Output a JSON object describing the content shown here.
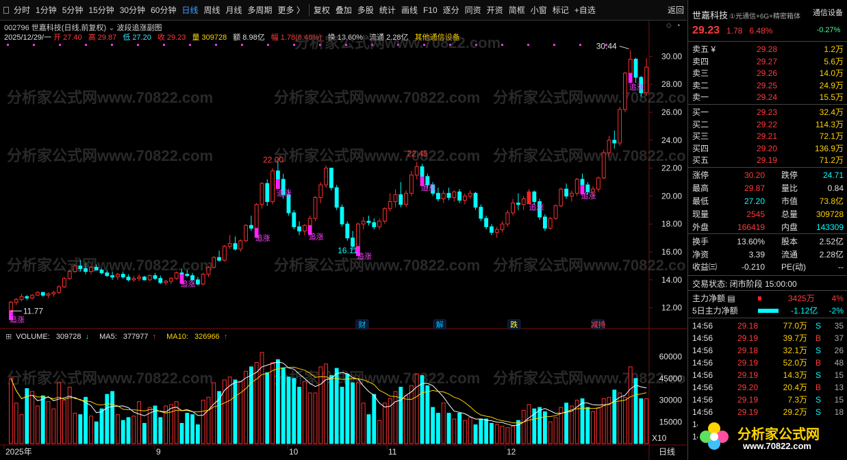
{
  "toolbar": {
    "periods": [
      "分时",
      "1分钟",
      "5分钟",
      "15分钟",
      "30分钟",
      "60分钟",
      "日线",
      "周线",
      "月线",
      "多周期",
      "更多 〉"
    ],
    "active": "日线",
    "tools": [
      "复权",
      "叠加",
      "多股",
      "统计",
      "画线",
      "F10",
      "逐分",
      "同资",
      "开资",
      "简框",
      "小窗",
      "标记",
      "+自选",
      "返回"
    ]
  },
  "stock": {
    "code": "002796",
    "name": "世嘉科技",
    "mode": "(日线,前复权)",
    "indicator": "波段追涨副图"
  },
  "quote_line": {
    "date": "2025/12/29/一",
    "open_label": "开",
    "open": "27.40",
    "high_label": "高",
    "high": "29.87",
    "low_label": "低",
    "low": "27.20",
    "close_label": "收",
    "close": "29.23",
    "vol_label": "量",
    "vol": "309728",
    "amt_label": "额",
    "amt": "8.98亿",
    "chg_label": "幅",
    "chg": "1.78(6.48%)",
    "turn_label": "换",
    "turn": "13.60%",
    "float_label": "流通",
    "float": "2.28亿",
    "sector": "其他通信设备"
  },
  "watermark": "分析家公式网www.70822.com",
  "chart_data": [
    {
      "type": "candlestick",
      "title": "",
      "ylim": [
        11,
        31
      ],
      "yticks": [
        12.0,
        14.0,
        16.0,
        18.0,
        20.0,
        22.0,
        24.0,
        26.0,
        28.0,
        30.0
      ],
      "xtick_labels": [
        "2025年",
        "9",
        "10",
        "11",
        "12"
      ],
      "annotations": {
        "max_labels": [
          "22.00",
          "22.45",
          "30.44"
        ],
        "min_labels": [
          "11.77",
          "16.11"
        ],
        "signal": "追涨",
        "events": [
          "财",
          "解",
          "跌",
          "减持"
        ]
      },
      "ohlc": [
        [
          11.8,
          12.5,
          11.77,
          12.4
        ],
        [
          12.4,
          12.7,
          12.2,
          12.6
        ],
        [
          12.6,
          13.0,
          12.45,
          12.8
        ],
        [
          12.8,
          12.9,
          12.55,
          12.7
        ],
        [
          12.7,
          13.0,
          12.6,
          12.9
        ],
        [
          12.9,
          13.2,
          12.85,
          13.1
        ],
        [
          13.1,
          13.0,
          12.8,
          12.9
        ],
        [
          12.9,
          13.1,
          12.7,
          13.0
        ],
        [
          13.0,
          13.2,
          12.8,
          13.1
        ],
        [
          13.1,
          13.6,
          13.0,
          13.5
        ],
        [
          13.5,
          14.2,
          13.4,
          14.1
        ],
        [
          14.1,
          14.7,
          14.0,
          14.6
        ],
        [
          14.6,
          15.1,
          14.5,
          15.0
        ],
        [
          15.0,
          15.4,
          14.6,
          14.8
        ],
        [
          14.8,
          15.2,
          14.4,
          14.6
        ],
        [
          14.6,
          15.0,
          14.4,
          14.9
        ],
        [
          14.9,
          15.1,
          14.7,
          14.7
        ],
        [
          14.7,
          14.8,
          14.4,
          14.5
        ],
        [
          14.5,
          14.7,
          14.2,
          14.3
        ],
        [
          14.3,
          14.6,
          14.0,
          14.2
        ],
        [
          14.2,
          14.5,
          14.0,
          14.4
        ],
        [
          14.4,
          14.6,
          14.1,
          14.2
        ],
        [
          14.2,
          14.4,
          13.9,
          14.0
        ],
        [
          14.0,
          14.3,
          13.85,
          14.1
        ],
        [
          14.1,
          14.4,
          13.9,
          14.2
        ],
        [
          14.2,
          14.3,
          13.95,
          14.0
        ],
        [
          14.0,
          14.4,
          13.9,
          14.3
        ],
        [
          14.3,
          14.5,
          14.0,
          14.1
        ],
        [
          14.1,
          14.3,
          13.7,
          13.8
        ],
        [
          13.8,
          14.0,
          13.6,
          13.9
        ],
        [
          13.9,
          14.2,
          13.7,
          14.1
        ],
        [
          14.1,
          14.6,
          14.0,
          14.5
        ],
        [
          14.5,
          14.8,
          14.3,
          14.4
        ],
        [
          14.4,
          14.7,
          14.2,
          14.3
        ],
        [
          14.3,
          14.5,
          13.9,
          14.0
        ],
        [
          14.0,
          14.2,
          13.6,
          13.7
        ],
        [
          13.7,
          14.5,
          13.6,
          14.4
        ],
        [
          14.4,
          15.0,
          14.2,
          14.9
        ],
        [
          14.9,
          15.7,
          14.8,
          15.6
        ],
        [
          15.6,
          16.1,
          15.3,
          15.4
        ],
        [
          15.4,
          16.5,
          15.3,
          16.4
        ],
        [
          16.4,
          17.2,
          16.2,
          16.6
        ],
        [
          16.6,
          17.1,
          16.1,
          16.2
        ],
        [
          16.2,
          16.9,
          16.0,
          16.8
        ],
        [
          16.8,
          18.0,
          16.7,
          17.9
        ],
        [
          17.9,
          18.6,
          17.5,
          17.7
        ],
        [
          17.7,
          19.5,
          17.6,
          19.4
        ],
        [
          19.4,
          21.0,
          19.1,
          20.9
        ],
        [
          20.9,
          21.2,
          19.3,
          19.6
        ],
        [
          19.6,
          22.0,
          19.4,
          21.8
        ],
        [
          21.8,
          22.5,
          20.8,
          21.2
        ],
        [
          21.2,
          21.6,
          19.8,
          20.1
        ],
        [
          20.1,
          20.5,
          18.6,
          18.8
        ],
        [
          18.8,
          19.0,
          17.6,
          17.8
        ],
        [
          17.8,
          18.2,
          17.2,
          17.5
        ],
        [
          17.5,
          18.0,
          17.2,
          17.9
        ],
        [
          17.9,
          18.6,
          17.7,
          18.4
        ],
        [
          18.4,
          20.0,
          18.2,
          19.9
        ],
        [
          19.9,
          21.0,
          19.5,
          20.8
        ],
        [
          20.8,
          22.2,
          20.6,
          22.0
        ],
        [
          22.0,
          21.9,
          20.4,
          20.6
        ],
        [
          20.6,
          20.8,
          19.0,
          19.2
        ],
        [
          19.2,
          19.4,
          17.8,
          18.0
        ],
        [
          18.0,
          18.2,
          16.8,
          17.0
        ],
        [
          17.0,
          17.5,
          16.11,
          16.4
        ],
        [
          16.4,
          18.1,
          16.3,
          18.0
        ],
        [
          18.0,
          18.5,
          17.6,
          18.2
        ],
        [
          18.2,
          18.6,
          17.9,
          18.1
        ],
        [
          18.1,
          18.4,
          17.6,
          17.8
        ],
        [
          17.8,
          18.4,
          17.6,
          18.2
        ],
        [
          18.2,
          19.2,
          18.0,
          19.1
        ],
        [
          19.1,
          20.2,
          18.9,
          19.6
        ],
        [
          19.6,
          20.5,
          19.2,
          20.1
        ],
        [
          20.1,
          21.0,
          19.2,
          19.4
        ],
        [
          19.4,
          20.4,
          19.2,
          20.2
        ],
        [
          20.2,
          21.8,
          20.0,
          21.5
        ],
        [
          21.5,
          22.45,
          21.2,
          22.1
        ],
        [
          22.1,
          22.3,
          21.2,
          21.4
        ],
        [
          21.4,
          21.6,
          20.5,
          20.8
        ],
        [
          20.8,
          21.0,
          20.0,
          20.2
        ],
        [
          20.2,
          20.6,
          19.6,
          19.8
        ],
        [
          19.8,
          20.4,
          19.5,
          20.2
        ],
        [
          20.2,
          20.6,
          19.7,
          19.9
        ],
        [
          19.9,
          20.4,
          19.6,
          20.3
        ],
        [
          20.3,
          20.5,
          19.5,
          19.7
        ],
        [
          19.7,
          20.2,
          19.4,
          20.0
        ],
        [
          20.0,
          20.4,
          19.8,
          20.2
        ],
        [
          20.2,
          20.3,
          19.0,
          19.2
        ],
        [
          19.2,
          19.4,
          18.2,
          18.4
        ],
        [
          18.4,
          18.6,
          17.6,
          17.8
        ],
        [
          17.8,
          18.0,
          17.2,
          17.4
        ],
        [
          17.4,
          17.8,
          17.0,
          17.6
        ],
        [
          17.6,
          18.2,
          17.4,
          18.0
        ],
        [
          18.0,
          19.0,
          17.8,
          18.8
        ],
        [
          18.8,
          19.8,
          18.6,
          19.5
        ],
        [
          19.5,
          20.2,
          19.0,
          19.4
        ],
        [
          19.4,
          20.0,
          19.0,
          19.8
        ],
        [
          19.8,
          20.5,
          19.6,
          20.3
        ],
        [
          20.3,
          20.4,
          19.4,
          19.6
        ],
        [
          19.6,
          19.8,
          18.3,
          18.5
        ],
        [
          18.5,
          18.7,
          17.5,
          17.7
        ],
        [
          17.7,
          18.5,
          17.6,
          18.4
        ],
        [
          18.4,
          19.4,
          18.3,
          19.3
        ],
        [
          19.3,
          20.6,
          19.2,
          20.5
        ],
        [
          20.5,
          20.9,
          19.8,
          20.0
        ],
        [
          20.0,
          20.4,
          19.6,
          20.2
        ],
        [
          20.2,
          21.3,
          20.0,
          21.2
        ],
        [
          21.2,
          21.6,
          20.6,
          20.8
        ],
        [
          20.8,
          21.0,
          20.1,
          20.3
        ],
        [
          20.3,
          20.7,
          19.9,
          20.5
        ],
        [
          20.5,
          21.4,
          20.3,
          21.3
        ],
        [
          21.3,
          23.3,
          21.2,
          23.1
        ],
        [
          23.1,
          24.3,
          22.8,
          24.0
        ],
        [
          24.0,
          24.7,
          23.4,
          23.8
        ],
        [
          23.8,
          26.4,
          23.6,
          26.2
        ],
        [
          26.2,
          28.9,
          26.0,
          28.8
        ],
        [
          28.8,
          30.44,
          28.4,
          29.8
        ],
        [
          29.8,
          29.9,
          28.1,
          28.5
        ],
        [
          28.5,
          28.6,
          27.1,
          27.4
        ],
        [
          27.4,
          29.87,
          27.2,
          29.23
        ]
      ],
      "signals": [
        0,
        32,
        46,
        50,
        56,
        65,
        77,
        107,
        116
      ],
      "short_labels": [
        97
      ]
    },
    {
      "type": "bar",
      "title": "",
      "header": {
        "vol_label": "VOLUME:",
        "vol_val": "309728",
        "ma5_label": "MA5:",
        "ma5_val": "377977",
        "ma10_label": "MA10:",
        "ma10_val": "326966"
      },
      "ylim": [
        0,
        70000
      ],
      "yticks": [
        15000,
        30000,
        45000,
        60000
      ],
      "unit": "X10",
      "values": [
        45000,
        28000,
        20000,
        38000,
        36000,
        26000,
        33000,
        29000,
        24000,
        42000,
        30000,
        39000,
        21000,
        20000,
        32000,
        19000,
        15000,
        24000,
        34000,
        36000,
        20000,
        16000,
        18000,
        19000,
        29000,
        14000,
        25000,
        26000,
        18000,
        26000,
        27000,
        29000,
        14000,
        21000,
        20000,
        13000,
        30000,
        32000,
        42000,
        36000,
        44000,
        46000,
        44000,
        43000,
        50000,
        53000,
        56000,
        63000,
        49000,
        56000,
        58000,
        52000,
        46000,
        45000,
        39000,
        43000,
        35000,
        35000,
        53000,
        55000,
        47000,
        52000,
        39000,
        48000,
        42000,
        42000,
        28000,
        20000,
        34000,
        16000,
        28000,
        31000,
        36000,
        39000,
        33000,
        40000,
        48000,
        47000,
        40000,
        25000,
        21000,
        28000,
        21000,
        17000,
        21000,
        16000,
        18000,
        13000,
        17000,
        17000,
        14000,
        13000,
        12000,
        11000,
        12000,
        16000,
        23000,
        27000,
        24000,
        25000,
        22000,
        15000,
        18000,
        25000,
        28000,
        26000,
        30000,
        31000,
        25000,
        22000,
        25000,
        31000,
        32000,
        37000,
        35000,
        32000,
        53000,
        45000,
        31000,
        31000
      ],
      "ma5_last": 37798,
      "ma10_last": 32697
    }
  ],
  "right_panel": {
    "name": "世嘉科技",
    "concept": "①光通信+6G+精密箱体",
    "sector": "通信设备",
    "sector_chg": "-0.27%",
    "price": "29.23",
    "chg": "1.78",
    "pct": "6.48%",
    "asks": [
      [
        "卖五",
        "¥",
        "29.28",
        "1.2万"
      ],
      [
        "卖四",
        "",
        "29.27",
        "5.6万"
      ],
      [
        "卖三",
        "",
        "29.26",
        "14.0万"
      ],
      [
        "卖二",
        "",
        "29.25",
        "24.9万"
      ],
      [
        "卖一",
        "",
        "29.24",
        "15.5万"
      ]
    ],
    "bids": [
      [
        "买一",
        "29.23",
        "32.4万"
      ],
      [
        "买二",
        "29.22",
        "114.3万"
      ],
      [
        "买三",
        "29.21",
        "72.1万"
      ],
      [
        "买四",
        "29.20",
        "136.9万"
      ],
      [
        "买五",
        "29.19",
        "71.2万"
      ]
    ],
    "stats": [
      [
        "涨停",
        "30.20",
        "跌停",
        "24.71"
      ],
      [
        "最高",
        "29.87",
        "量比",
        "0.84"
      ],
      [
        "最低",
        "27.20",
        "市值",
        "73.8亿"
      ],
      [
        "现量",
        "2545",
        "总量",
        "309728"
      ],
      [
        "外盘",
        "166419",
        "内盘",
        "143309"
      ]
    ],
    "stats2": [
      [
        "换手",
        "13.60%",
        "股本",
        "2.52亿"
      ],
      [
        "净资",
        "3.39",
        "流通",
        "2.28亿"
      ],
      [
        "收益㈢",
        "-0.210",
        "PE(动)",
        "--"
      ]
    ],
    "trade_state": "交易状态: 闭市阶段 15:00:00",
    "main_flow": {
      "label": "主力净额",
      "value": "3425万",
      "pct": "4%"
    },
    "flow5": {
      "label": "5日主力净额",
      "value": "-1.12亿",
      "pct": "-2%"
    },
    "ticks": [
      [
        "14:56",
        "29.18",
        "77.0万",
        "S",
        "35"
      ],
      [
        "14:56",
        "29.19",
        "39.7万",
        "B",
        "37"
      ],
      [
        "14:56",
        "29.18",
        "32.1万",
        "S",
        "26"
      ],
      [
        "14:56",
        "29.19",
        "52.0万",
        "B",
        "48"
      ],
      [
        "14:56",
        "29.19",
        "14.3万",
        "S",
        "15"
      ],
      [
        "14:56",
        "29.20",
        "20.4万",
        "B",
        "13"
      ],
      [
        "14:56",
        "29.19",
        "7.3万",
        "S",
        "15"
      ],
      [
        "14:56",
        "29.19",
        "29.2万",
        "S",
        "18"
      ],
      [
        "14",
        "",
        "",
        "",
        ""
      ],
      [
        "14",
        "",
        "",
        "",
        ""
      ]
    ],
    "period_tab": "日线",
    "logo": {
      "text": "分析家公式网",
      "url": "www.70822.com"
    }
  }
}
